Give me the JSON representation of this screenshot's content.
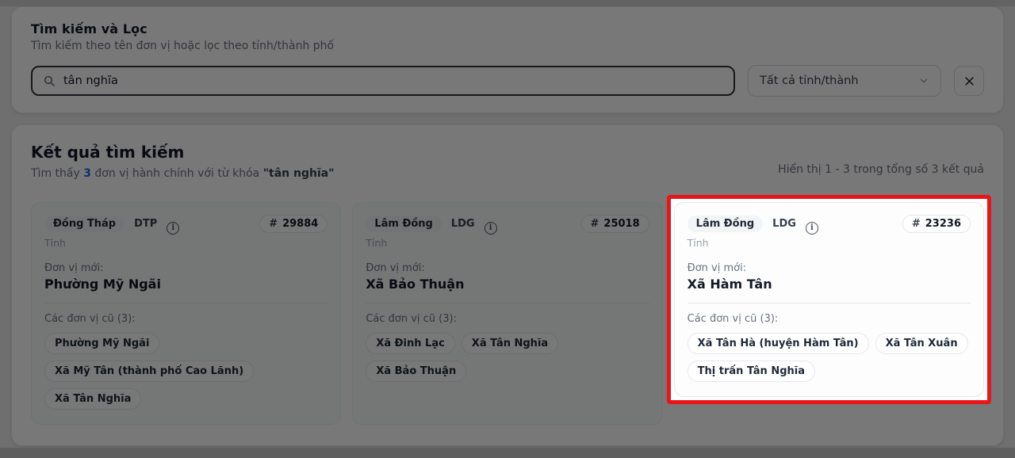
{
  "colors": {
    "accent_blue": "#2563eb",
    "highlight_red": "#e8151b",
    "panel_bg": "#ffffff",
    "card_bg": "#f9fafb"
  },
  "icons": {
    "search": "magnifier",
    "chevron": "chevron-down",
    "clear": "x-mark",
    "info": "i"
  },
  "search_panel": {
    "title": "Tìm kiếm và Lọc",
    "subtitle": "Tìm kiếm theo tên đơn vị hoặc lọc theo tỉnh/thành phố",
    "search_value": "tân nghĩa",
    "province_filter_value": "Tất cả tỉnh/thành"
  },
  "results_panel": {
    "title": "Kết quả tìm kiếm",
    "found_prefix": "Tìm thấy",
    "found_count": "3",
    "found_middle": "đơn vị hành chính với từ khóa",
    "found_keyword": "\"tân nghĩa\"",
    "showing_text": "Hiển thị 1 - 3 trong tổng số 3 kết quả",
    "cards": [
      {
        "province": "Đồng Tháp",
        "code": "DTP",
        "id_hash": "#",
        "id_number": "29884",
        "level": "Tỉnh",
        "new_unit_label": "Đơn vị mới:",
        "new_unit": "Phường Mỹ Ngãi",
        "old_units_label": "Các đơn vị cũ (3):",
        "old_units": [
          "Phường Mỹ Ngãi",
          "Xã Mỹ Tân (thành phố Cao Lãnh)",
          "Xã Tân Nghĩa"
        ],
        "highlighted": false
      },
      {
        "province": "Lâm Đồng",
        "code": "LDG",
        "id_hash": "#",
        "id_number": "25018",
        "level": "Tỉnh",
        "new_unit_label": "Đơn vị mới:",
        "new_unit": "Xã Bảo Thuận",
        "old_units_label": "Các đơn vị cũ (3):",
        "old_units": [
          "Xã Đinh Lạc",
          "Xã Tân Nghĩa",
          "Xã Bảo Thuận"
        ],
        "highlighted": false
      },
      {
        "province": "Lâm Đồng",
        "code": "LDG",
        "id_hash": "#",
        "id_number": "23236",
        "level": "Tỉnh",
        "new_unit_label": "Đơn vị mới:",
        "new_unit": "Xã Hàm Tân",
        "old_units_label": "Các đơn vị cũ (3):",
        "old_units": [
          "Xã Tân Hà (huyện Hàm Tân)",
          "Xã Tân Xuân",
          "Thị trấn Tân Nghĩa"
        ],
        "highlighted": true
      }
    ]
  }
}
